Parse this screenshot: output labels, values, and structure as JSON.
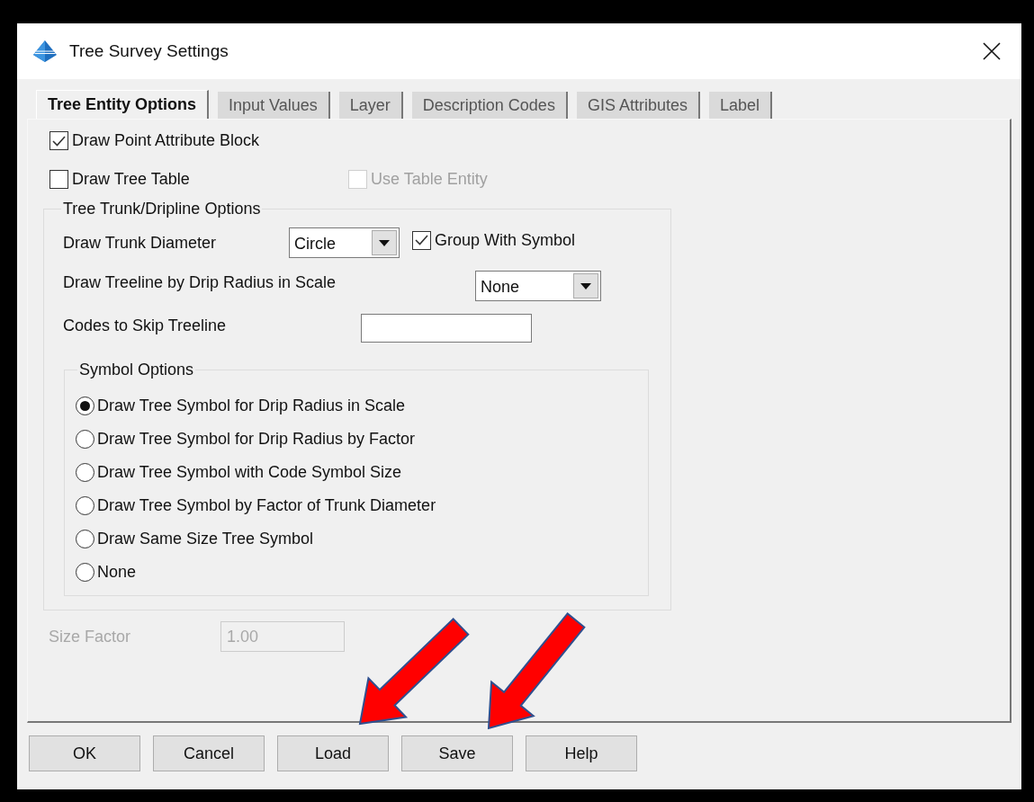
{
  "window": {
    "title": "Tree Survey Settings"
  },
  "tabs": [
    {
      "label": "Tree Entity Options",
      "selected": true
    },
    {
      "label": "Input Values",
      "selected": false
    },
    {
      "label": "Layer",
      "selected": false
    },
    {
      "label": "Description Codes",
      "selected": false
    },
    {
      "label": "GIS Attributes",
      "selected": false
    },
    {
      "label": "Label",
      "selected": false
    }
  ],
  "checkboxes": [
    {
      "label": "Draw Point Attribute Block",
      "checked": true,
      "disabled": false
    },
    {
      "label": "Draw Tree Table",
      "checked": false,
      "disabled": false
    },
    {
      "label": "Use Table Entity",
      "checked": false,
      "disabled": true
    }
  ],
  "trunk_group": {
    "title": "Tree Trunk/Dripline Options",
    "trunk_diameter": {
      "label": "Draw Trunk Diameter",
      "value": "Circle"
    },
    "group_with_symbol": {
      "label": "Group With Symbol",
      "checked": true
    },
    "treeline": {
      "label": "Draw Treeline by Drip Radius in Scale",
      "value": "None"
    },
    "skip_codes": {
      "label": "Codes to Skip Treeline"
    },
    "symbol_options": {
      "title": "Symbol Options",
      "options": [
        {
          "label": "Draw Tree Symbol for Drip Radius in Scale",
          "selected": true
        },
        {
          "label": "Draw Tree Symbol for Drip Radius by Factor",
          "selected": false
        },
        {
          "label": "Draw Tree Symbol with Code Symbol Size",
          "selected": false
        },
        {
          "label": "Draw Tree Symbol by Factor of Trunk Diameter",
          "selected": false
        },
        {
          "label": "Draw Same Size Tree Symbol",
          "selected": false
        },
        {
          "label": "None",
          "selected": false
        }
      ]
    }
  },
  "size_factor": {
    "label": "Size Factor",
    "value": "1.00",
    "disabled": true
  },
  "buttons": [
    "OK",
    "Cancel",
    "Load",
    "Save",
    "Help"
  ]
}
